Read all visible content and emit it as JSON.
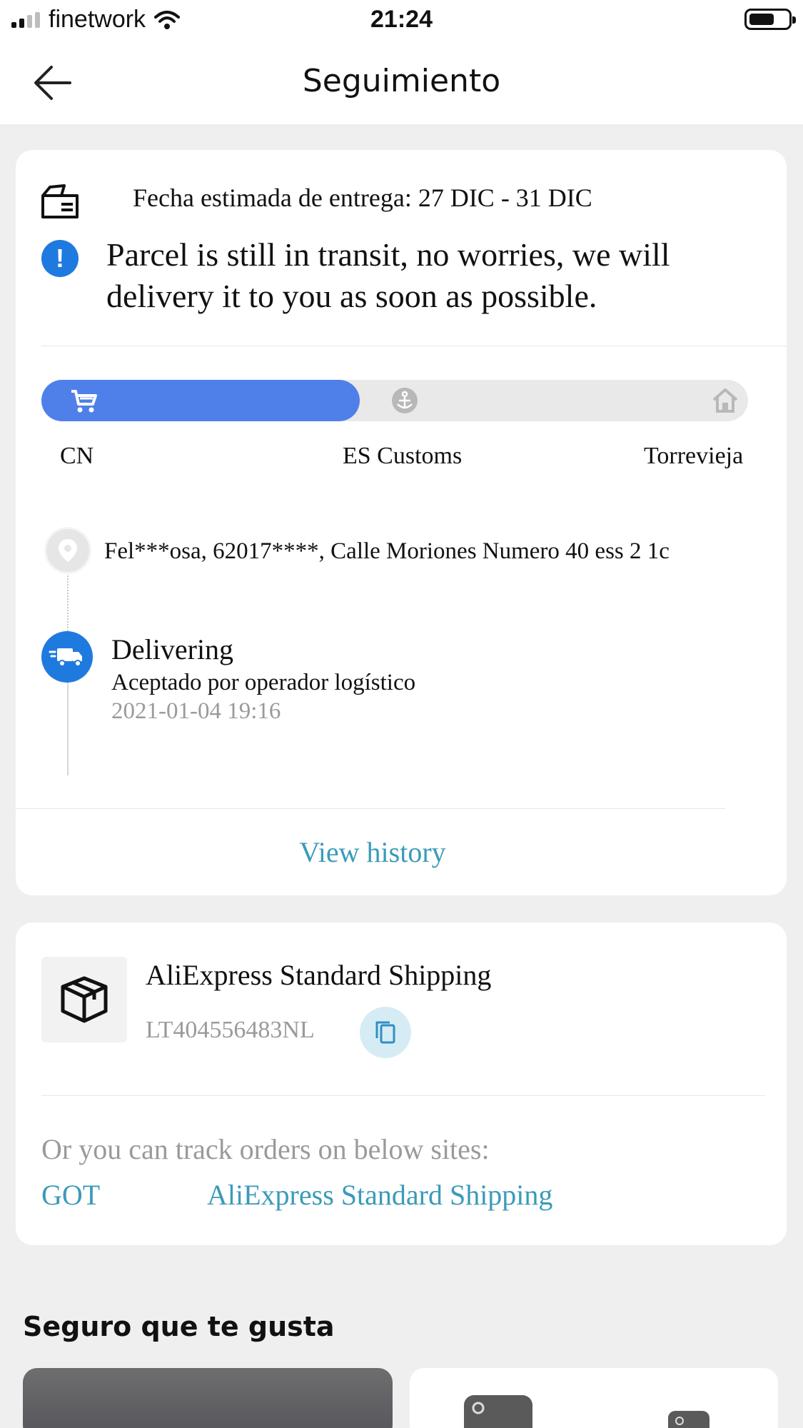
{
  "status_bar": {
    "carrier": "finetwork",
    "time": "21:24"
  },
  "nav": {
    "title": "Seguimiento"
  },
  "delivery": {
    "estimated": "Fecha estimada de entrega: 27 DIC - 31 DIC",
    "notice": "Parcel is still in transit, no worries, we will delivery it to you as soon as possible.",
    "progress_fraction": 0.45,
    "stops": [
      "CN",
      "ES Customs",
      "Torrevieja"
    ],
    "accent_color": "#4f80ea"
  },
  "address": {
    "text": "Fel***osa,  62017****,  Calle Moriones Numero 40 ess 2 1c"
  },
  "latest_event": {
    "status": "Delivering",
    "detail": "Aceptado por operador logístico",
    "timestamp": "2021-01-04 19:16"
  },
  "view_history_label": "View history",
  "shipping": {
    "carrier": "AliExpress Standard Shipping",
    "tracking_number": "LT404556483NL",
    "track_sites_label": "Or you can track orders on below sites:",
    "sites": [
      "GOT",
      "AliExpress Standard Shipping"
    ],
    "link_color": "#3a9bb8"
  },
  "recommendations": {
    "title": "Seguro que te gusta"
  },
  "icons": {
    "back": "arrow-left-icon",
    "eta": "delivery-box-icon",
    "info": "info-icon",
    "cart": "cart-icon",
    "customs": "anchor-icon",
    "destination": "home-icon",
    "address": "location-pin-icon",
    "status": "truck-icon",
    "package": "package-icon",
    "copy": "copy-icon"
  }
}
